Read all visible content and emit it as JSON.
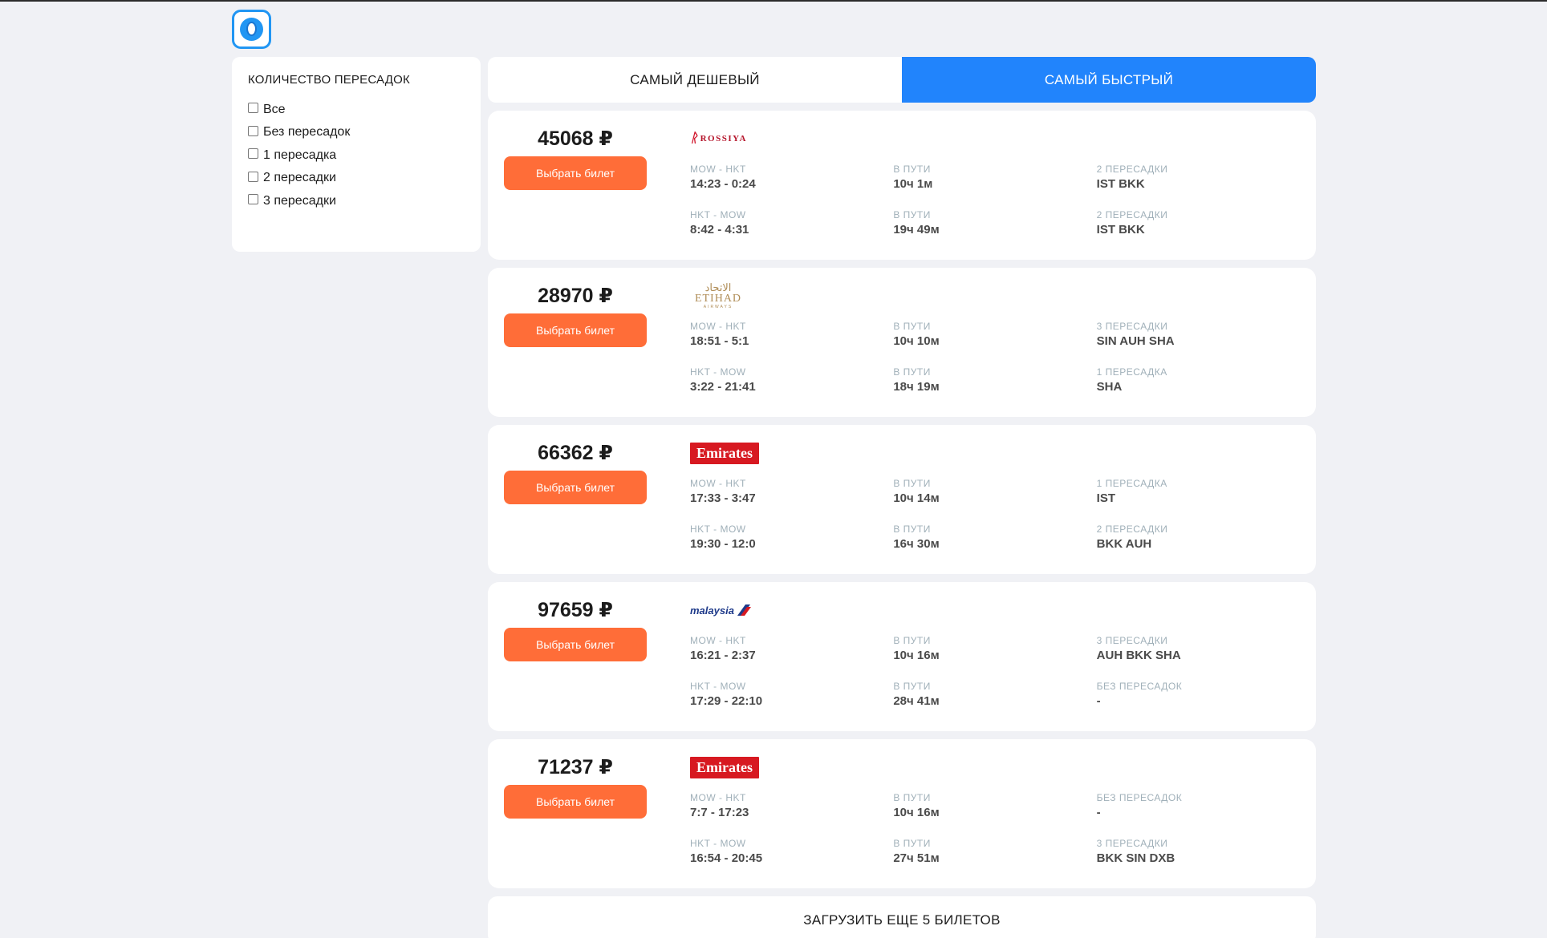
{
  "app": {
    "logo_icon": "airplane-window-icon",
    "accent": "#2184fc",
    "button_color": "#ff6d38"
  },
  "filter": {
    "title": "КОЛИЧЕСТВО ПЕРЕСАДОК",
    "options": [
      {
        "label": "Все",
        "checked": false
      },
      {
        "label": "Без пересадок",
        "checked": false
      },
      {
        "label": "1 пересадка",
        "checked": false
      },
      {
        "label": "2 пересадки",
        "checked": false
      },
      {
        "label": "3 пересадки",
        "checked": false
      }
    ]
  },
  "tabs": {
    "cheapest": "САМЫЙ ДЕШЕВЫЙ",
    "fastest": "САМЫЙ БЫСТРЫЙ",
    "active": "fastest"
  },
  "tickets": [
    {
      "price": "45068 ₽",
      "button": "Выбрать билет",
      "carrier": "ROSSIYA",
      "segments": [
        {
          "route": "MOW - HKT",
          "time": "14:23 - 0:24",
          "duration_label": "В ПУТИ",
          "duration": "10ч 1м",
          "stops_label": "2 ПЕРЕСАДКИ",
          "stops": "IST BKK"
        },
        {
          "route": "HKT - MOW",
          "time": "8:42 - 4:31",
          "duration_label": "В ПУТИ",
          "duration": "19ч 49м",
          "stops_label": "2 ПЕРЕСАДКИ",
          "stops": "IST BKK"
        }
      ]
    },
    {
      "price": "28970 ₽",
      "button": "Выбрать билет",
      "carrier": "ETIHAD",
      "carrier_ar": "الاتحاد",
      "carrier_sub": "AIRWAYS",
      "segments": [
        {
          "route": "MOW - HKT",
          "time": "18:51 - 5:1",
          "duration_label": "В ПУТИ",
          "duration": "10ч 10м",
          "stops_label": "3 ПЕРЕСАДКИ",
          "stops": "SIN AUH SHA"
        },
        {
          "route": "HKT - MOW",
          "time": "3:22 - 21:41",
          "duration_label": "В ПУТИ",
          "duration": "18ч 19м",
          "stops_label": "1 ПЕРЕСАДКА",
          "stops": "SHA"
        }
      ]
    },
    {
      "price": "66362 ₽",
      "button": "Выбрать билет",
      "carrier": "Emirates",
      "segments": [
        {
          "route": "MOW - HKT",
          "time": "17:33 - 3:47",
          "duration_label": "В ПУТИ",
          "duration": "10ч 14м",
          "stops_label": "1 ПЕРЕСАДКА",
          "stops": "IST"
        },
        {
          "route": "HKT - MOW",
          "time": "19:30 - 12:0",
          "duration_label": "В ПУТИ",
          "duration": "16ч 30м",
          "stops_label": "2 ПЕРЕСАДКИ",
          "stops": "BKK AUH"
        }
      ]
    },
    {
      "price": "97659 ₽",
      "button": "Выбрать билет",
      "carrier": "malaysia",
      "segments": [
        {
          "route": "MOW - HKT",
          "time": "16:21 - 2:37",
          "duration_label": "В ПУТИ",
          "duration": "10ч 16м",
          "stops_label": "3 ПЕРЕСАДКИ",
          "stops": "AUH BKK SHA"
        },
        {
          "route": "HKT - MOW",
          "time": "17:29 - 22:10",
          "duration_label": "В ПУТИ",
          "duration": "28ч 41м",
          "stops_label": "БЕЗ ПЕРЕСАДОК",
          "stops": "-"
        }
      ]
    },
    {
      "price": "71237 ₽",
      "button": "Выбрать билет",
      "carrier": "Emirates",
      "segments": [
        {
          "route": "MOW - HKT",
          "time": "7:7 - 17:23",
          "duration_label": "В ПУТИ",
          "duration": "10ч 16м",
          "stops_label": "БЕЗ ПЕРЕСАДОК",
          "stops": "-"
        },
        {
          "route": "HKT - MOW",
          "time": "16:54 - 20:45",
          "duration_label": "В ПУТИ",
          "duration": "27ч 51м",
          "stops_label": "3 ПЕРЕСАДКИ",
          "stops": "BKK SIN DXB"
        }
      ]
    }
  ],
  "load_more": "ЗАГРУЗИТЬ ЕЩЕ 5 БИЛЕТОВ"
}
